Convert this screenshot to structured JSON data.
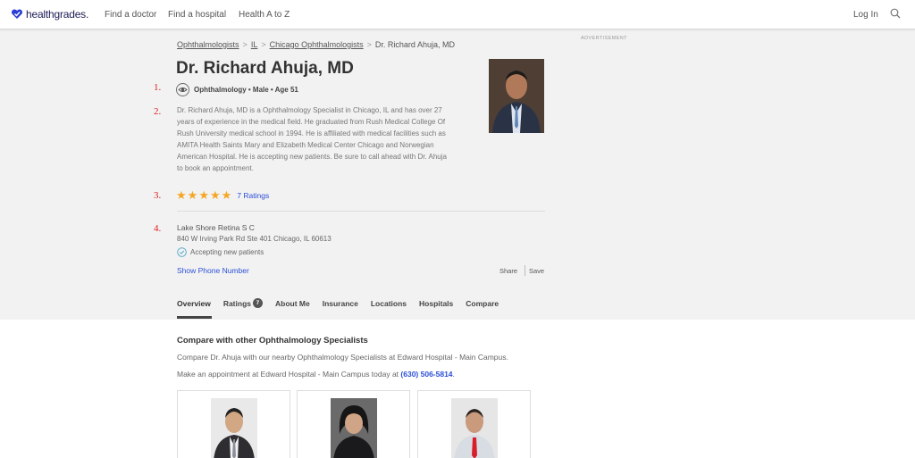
{
  "nav": {
    "logo_text": "healthgrades.",
    "links": [
      "Find a doctor",
      "Find a hospital",
      "Health A to Z"
    ],
    "login": "Log In"
  },
  "breadcrumb": {
    "items": [
      "Ophthalmologists",
      "IL",
      "Chicago Ophthalmologists"
    ],
    "current": "Dr. Richard Ahuja, MD",
    "separator": ">"
  },
  "ad_label": "ADVERTISEMENT",
  "doctor": {
    "name": "Dr. Richard Ahuja, MD",
    "specialty_line": "Ophthalmology • Male • Age 51",
    "bio": "Dr. Richard Ahuja, MD is a Ophthalmology Specialist in Chicago, IL and has over 27 years of experience in the medical field.  He graduated from Rush Medical College Of Rush University medical school in 1994.  He is affiliated with medical facilities such as AMITA Health Saints Mary and Elizabeth Medical Center Chicago and Norwegian American Hospital.  He is accepting new patients.  Be sure to call ahead with Dr. Ahuja to book an appointment.",
    "rating_stars": 5,
    "ratings_label": "7 Ratings"
  },
  "markers": [
    "1.",
    "2.",
    "3.",
    "4."
  ],
  "location": {
    "practice": "Lake Shore Retina S C",
    "address": "840 W Irving Park Rd Ste 401 Chicago, IL 60613",
    "accepting": "Accepting new patients",
    "phone_link": "Show Phone Number",
    "share": "Share",
    "save": "Save"
  },
  "tabs": [
    {
      "label": "Overview",
      "badge": ""
    },
    {
      "label": "Ratings",
      "badge": "7"
    },
    {
      "label": "About Me",
      "badge": ""
    },
    {
      "label": "Insurance",
      "badge": ""
    },
    {
      "label": "Locations",
      "badge": ""
    },
    {
      "label": "Hospitals",
      "badge": ""
    },
    {
      "label": "Compare",
      "badge": ""
    }
  ],
  "compare": {
    "title": "Compare with other Ophthalmology Specialists",
    "line1": "Compare Dr. Ahuja with our nearby Ophthalmology Specialists at Edward Hospital - Main Campus.",
    "line2_prefix": "Make an appointment at Edward Hospital - Main Campus today at ",
    "line2_phone": "(630) 506-5814",
    "line2_suffix": "."
  },
  "colors": {
    "link": "#2b4fd8",
    "star": "#f5a623",
    "marker": "#dd2222",
    "panel_bg": "#f2f2f2",
    "logo_heart": "#2b3fd6"
  },
  "icons": [
    "heart-logo-icon",
    "search-icon",
    "eye-icon",
    "star-icon",
    "checkmark-circle-icon"
  ]
}
